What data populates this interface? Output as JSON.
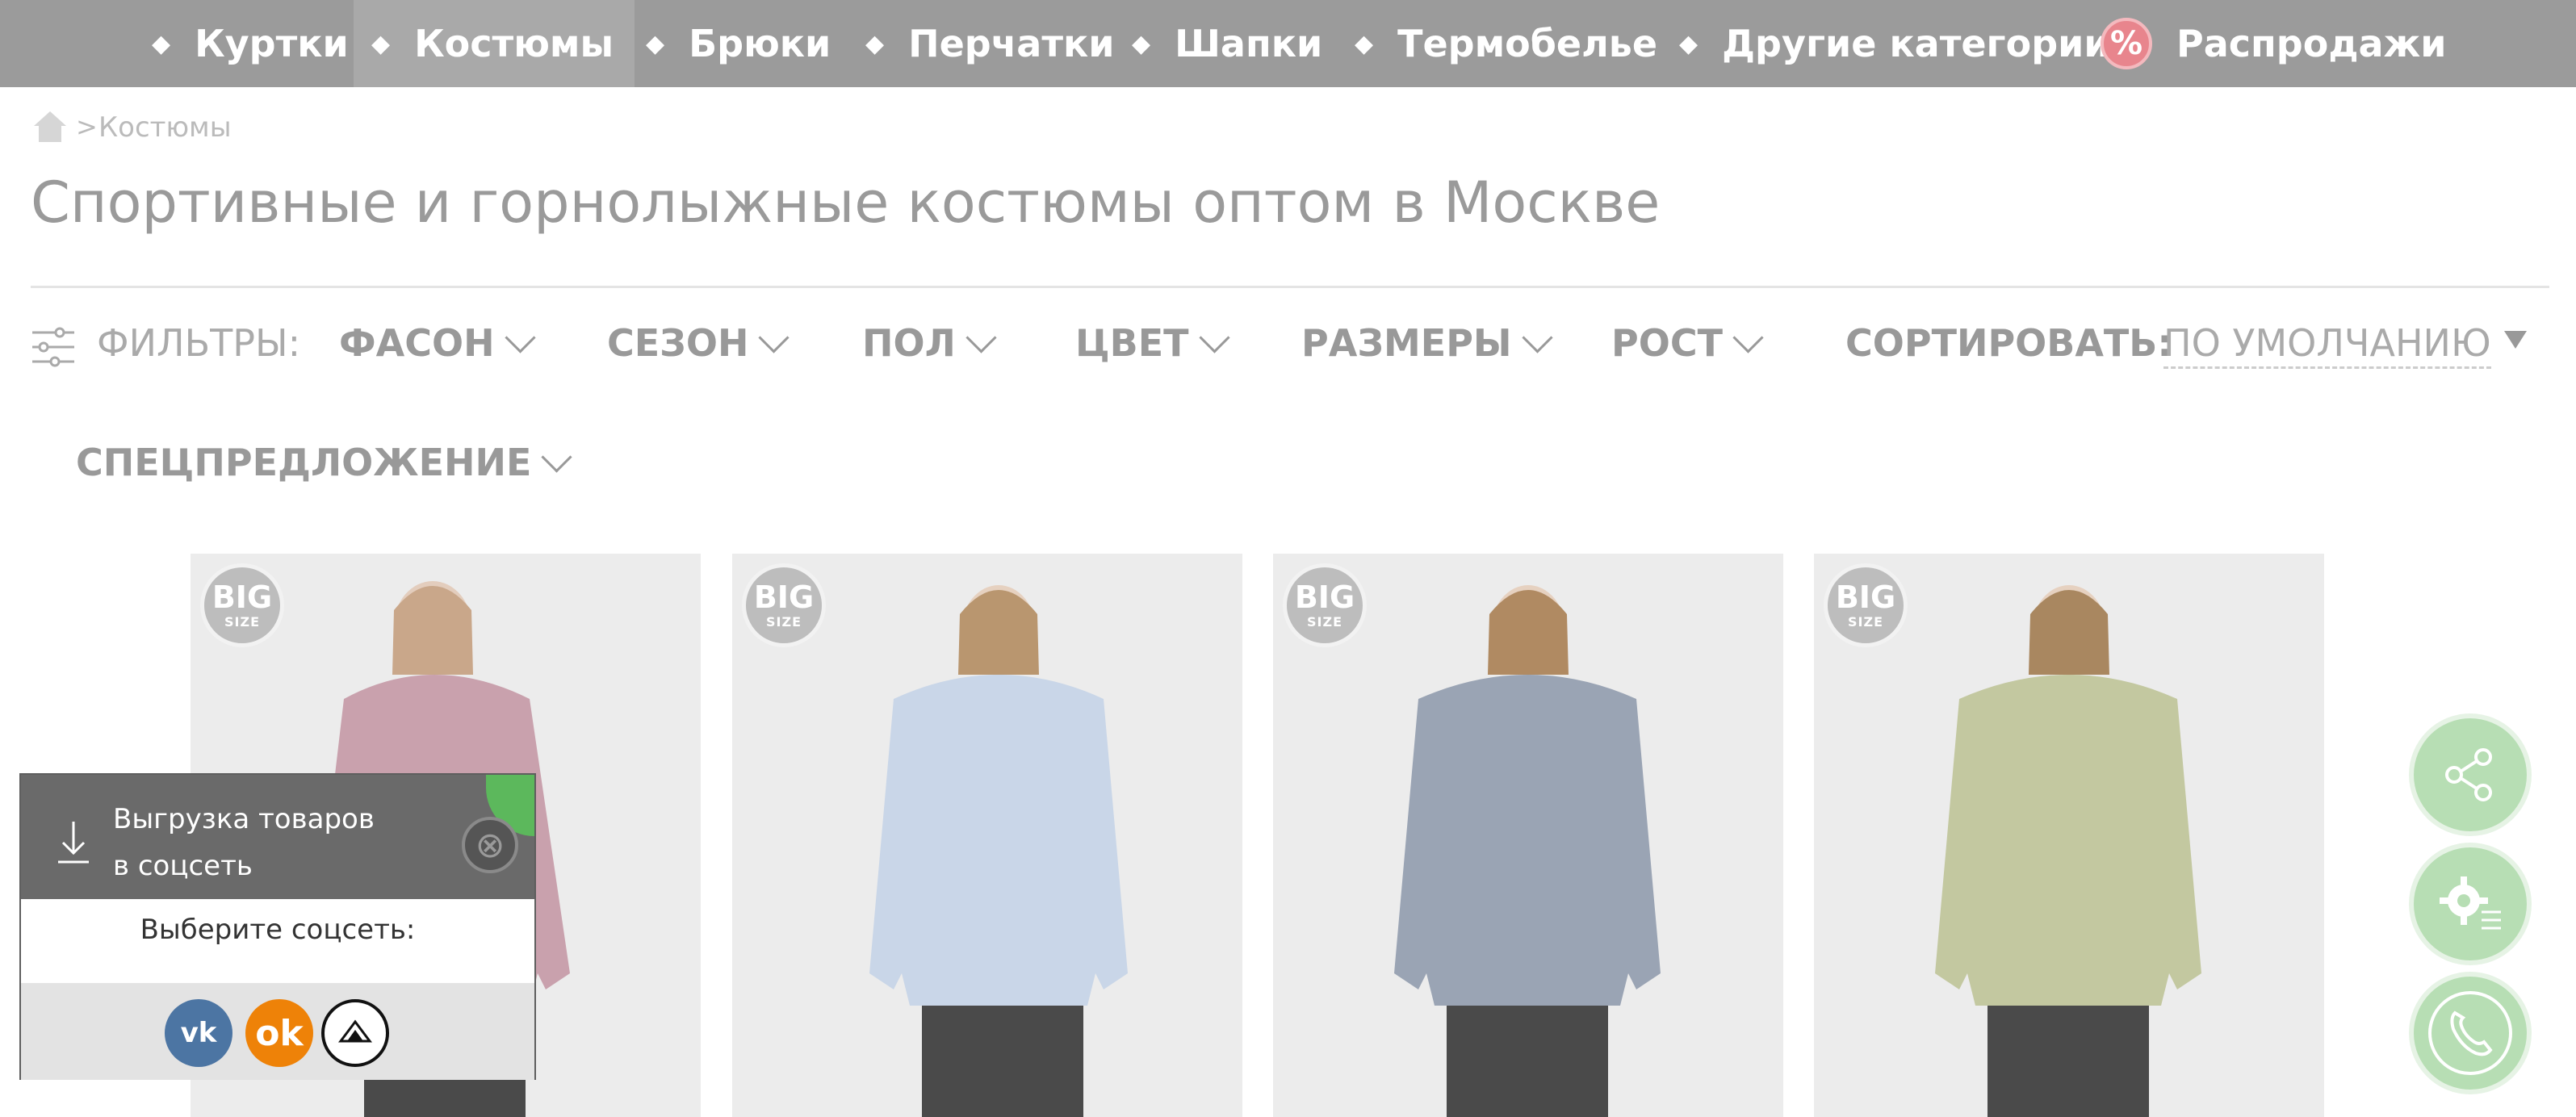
{
  "nav": {
    "items": [
      {
        "label": "Куртки"
      },
      {
        "label": "Костюмы",
        "active": true
      },
      {
        "label": "Брюки"
      },
      {
        "label": "Перчатки"
      },
      {
        "label": "Шапки"
      },
      {
        "label": "Термобелье"
      },
      {
        "label": "Другие категории"
      },
      {
        "label": "Распродажи",
        "icon": "percent-icon"
      }
    ]
  },
  "breadcrumb": {
    "current": "Костюмы",
    "separator": ">"
  },
  "page_title": "Спортивные и горнолыжные костюмы оптом в Москве",
  "filters": {
    "label": "ФИЛЬТРЫ:",
    "items": [
      "ФАСОН",
      "СЕЗОН",
      "ПОЛ",
      "ЦВЕТ",
      "РАЗМЕРЫ",
      "РОСТ",
      "СПЕЦПРЕДЛОЖЕНИЕ"
    ],
    "sort_label": "СОРТИРОВАТЬ:",
    "sort_value": "ПО УМОЛЧАНИЮ"
  },
  "products": [
    {
      "badge_top": "BIG",
      "badge_bottom": "SIZE",
      "jacket_color": "#c9a1ad"
    },
    {
      "badge_top": "BIG",
      "badge_bottom": "SIZE",
      "jacket_color": "#c9d6e8"
    },
    {
      "badge_top": "BIG",
      "badge_bottom": "SIZE",
      "jacket_color": "#9aa4b4"
    },
    {
      "badge_top": "BIG",
      "badge_bottom": "SIZE",
      "jacket_color": "#c3c8a0"
    }
  ],
  "social_popup": {
    "title_line1": "Выгрузка товаров",
    "title_line2": "в соцсеть",
    "choose_label": "Выберите соцсеть:",
    "networks": [
      {
        "name": "VK",
        "color": "#4c75a3"
      },
      {
        "name": "OK",
        "color": "#ee8208"
      },
      {
        "name": "other",
        "color": "#111111"
      }
    ]
  },
  "colors": {
    "nav_bg": "#9b9b9b",
    "fab_green": "#b7deb4",
    "sale_badge": "#e8858d"
  }
}
